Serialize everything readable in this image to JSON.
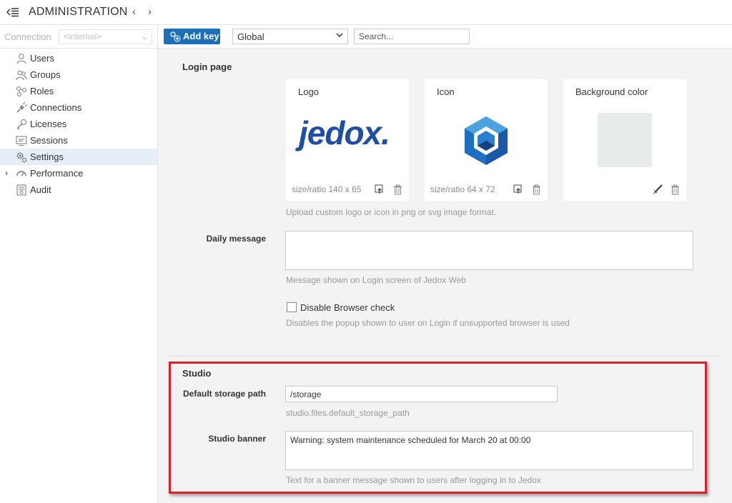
{
  "header": {
    "title": "ADMINISTRATION",
    "back_arrow": "‹",
    "forward_arrow": "›",
    "menu_icon": "sidebar-collapse-icon"
  },
  "sidebar": {
    "connection_label": "Connection",
    "connection_value": "<internal>",
    "items": [
      {
        "label": "Users",
        "icon": "user-icon"
      },
      {
        "label": "Groups",
        "icon": "group-icon"
      },
      {
        "label": "Roles",
        "icon": "roles-icon"
      },
      {
        "label": "Connections",
        "icon": "plug-icon"
      },
      {
        "label": "Licenses",
        "icon": "key-icon"
      },
      {
        "label": "Sessions",
        "icon": "monitor-icon"
      },
      {
        "label": "Settings",
        "icon": "gear-icon",
        "active": true
      },
      {
        "label": "Performance",
        "icon": "gauge-icon",
        "expander": "›"
      },
      {
        "label": "Audit",
        "icon": "audit-icon"
      }
    ]
  },
  "toolbar": {
    "add_key_label": "Add key",
    "scope_value": "Global",
    "search_placeholder": "Search..."
  },
  "login_page": {
    "title": "Login page",
    "logo": {
      "title": "Logo",
      "brand_text": "jedox.",
      "meta": "size/ratio 140 x 65"
    },
    "icon": {
      "title": "Icon",
      "meta": "size/ratio 64 x 72"
    },
    "background": {
      "title": "Background color",
      "swatch_color": "#e7ebeb"
    },
    "upload_hint": "Upload custom logo or icon in png or svg image format.",
    "daily_message_label": "Daily message",
    "daily_message_value": "",
    "daily_message_hint": "Message shown on Login screen of Jedox Web",
    "browser_check_label": "Disable Browser check",
    "browser_check_hint": "Disables the popup shown to user on Login if unsupported browser is used"
  },
  "studio": {
    "title": "Studio",
    "storage_label": "Default storage path",
    "storage_value": "/storage",
    "storage_hint": "studio.files.default_storage_path",
    "banner_label": "Studio banner",
    "banner_value": "Warning: system maintenance scheduled for March 20 at 00:00",
    "banner_hint": "Text for a banner message shown to users after logging in to Jedox"
  },
  "colors": {
    "accent": "#1d6fb8",
    "logo_blue": "#1e4fa3",
    "highlight": "#d7242c",
    "active_row": "#e6eef7"
  }
}
